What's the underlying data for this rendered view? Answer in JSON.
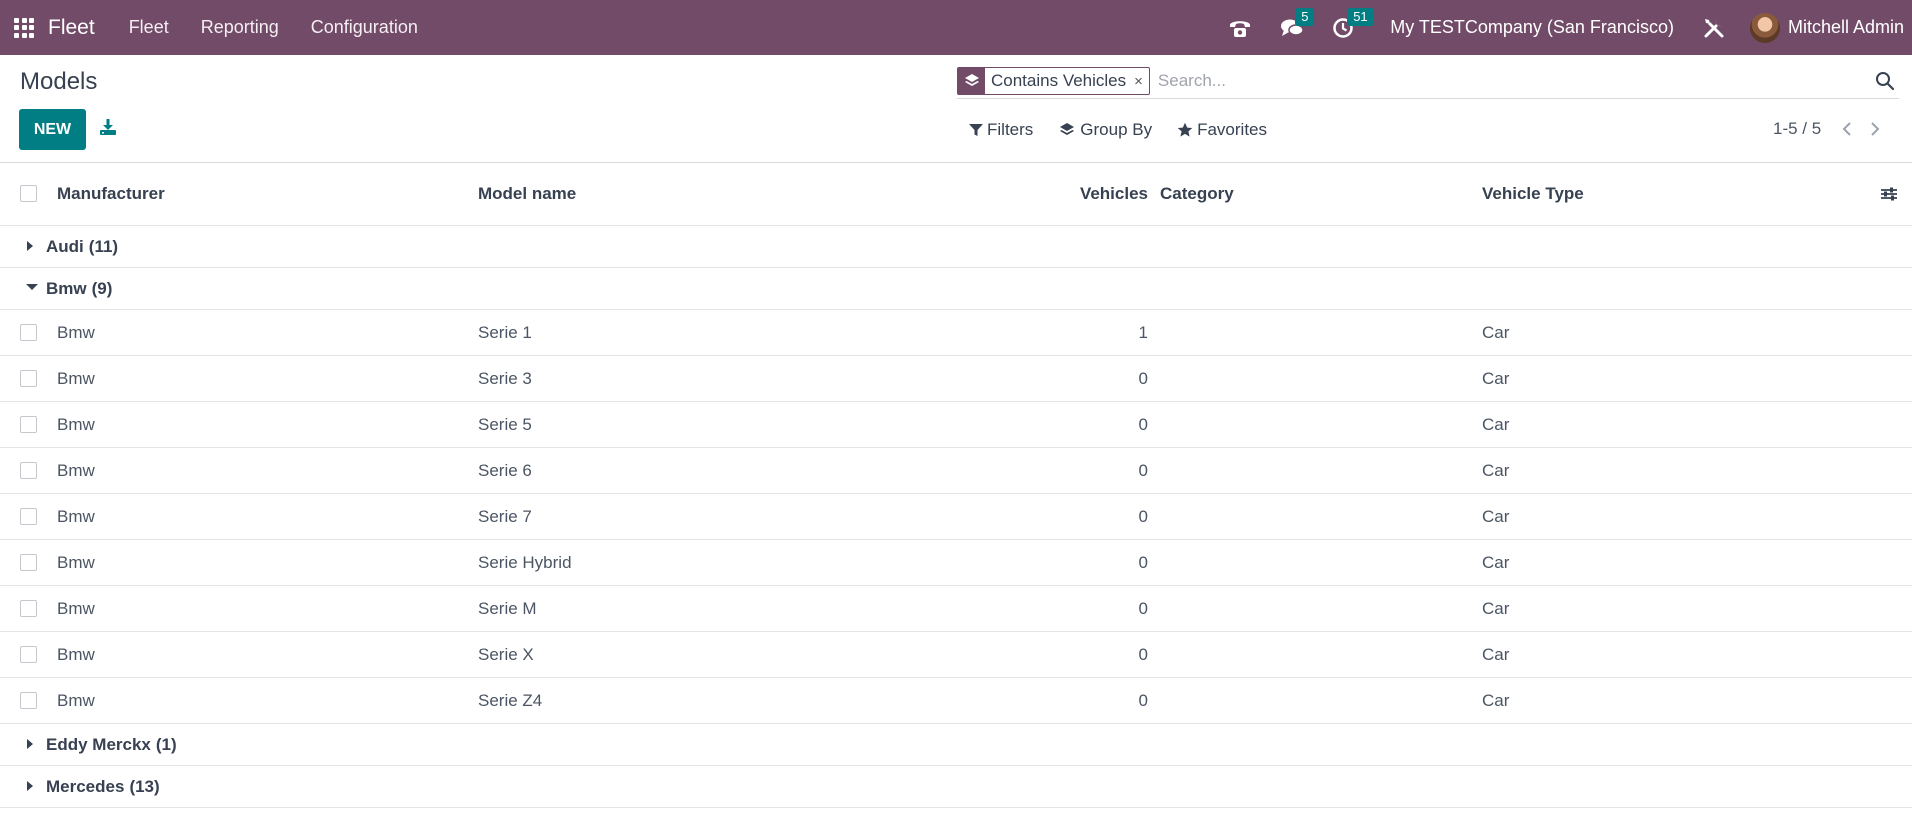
{
  "navbar": {
    "app_name": "Fleet",
    "menu": [
      "Fleet",
      "Reporting",
      "Configuration"
    ],
    "messages_count": "5",
    "activities_count": "51",
    "company": "My TESTCompany (San Francisco)",
    "user": "Mitchell Admin",
    "icons": [
      "apps-grid-icon",
      "phone-icon",
      "chat-icon",
      "clock-icon",
      "settings-tools-icon"
    ]
  },
  "page": {
    "title": "Models",
    "new_label": "NEW"
  },
  "search": {
    "facet_value": "Contains Vehicles",
    "facet_remove": "×",
    "placeholder": "Search...",
    "options": [
      "Filters",
      "Group By",
      "Favorites"
    ]
  },
  "pager": {
    "value": "1-5 / 5"
  },
  "list": {
    "columns": [
      "Manufacturer",
      "Model name",
      "Vehicles",
      "Category",
      "Vehicle Type"
    ],
    "groups": [
      {
        "name": "Audi",
        "count": "(11)",
        "expanded": false,
        "rows": []
      },
      {
        "name": "Bmw",
        "count": "(9)",
        "expanded": true,
        "rows": [
          {
            "manufacturer": "Bmw",
            "model": "Serie 1",
            "vehicles": "1",
            "category": "",
            "type": "Car"
          },
          {
            "manufacturer": "Bmw",
            "model": "Serie 3",
            "vehicles": "0",
            "category": "",
            "type": "Car"
          },
          {
            "manufacturer": "Bmw",
            "model": "Serie 5",
            "vehicles": "0",
            "category": "",
            "type": "Car"
          },
          {
            "manufacturer": "Bmw",
            "model": "Serie 6",
            "vehicles": "0",
            "category": "",
            "type": "Car"
          },
          {
            "manufacturer": "Bmw",
            "model": "Serie 7",
            "vehicles": "0",
            "category": "",
            "type": "Car"
          },
          {
            "manufacturer": "Bmw",
            "model": "Serie Hybrid",
            "vehicles": "0",
            "category": "",
            "type": "Car"
          },
          {
            "manufacturer": "Bmw",
            "model": "Serie M",
            "vehicles": "0",
            "category": "",
            "type": "Car"
          },
          {
            "manufacturer": "Bmw",
            "model": "Serie X",
            "vehicles": "0",
            "category": "",
            "type": "Car"
          },
          {
            "manufacturer": "Bmw",
            "model": "Serie Z4",
            "vehicles": "0",
            "category": "",
            "type": "Car"
          }
        ]
      },
      {
        "name": "Eddy Merckx",
        "count": "(1)",
        "expanded": false,
        "rows": []
      },
      {
        "name": "Mercedes",
        "count": "(13)",
        "expanded": false,
        "rows": []
      }
    ]
  },
  "colors": {
    "navbar": "#714B67",
    "primary": "#017E84"
  }
}
